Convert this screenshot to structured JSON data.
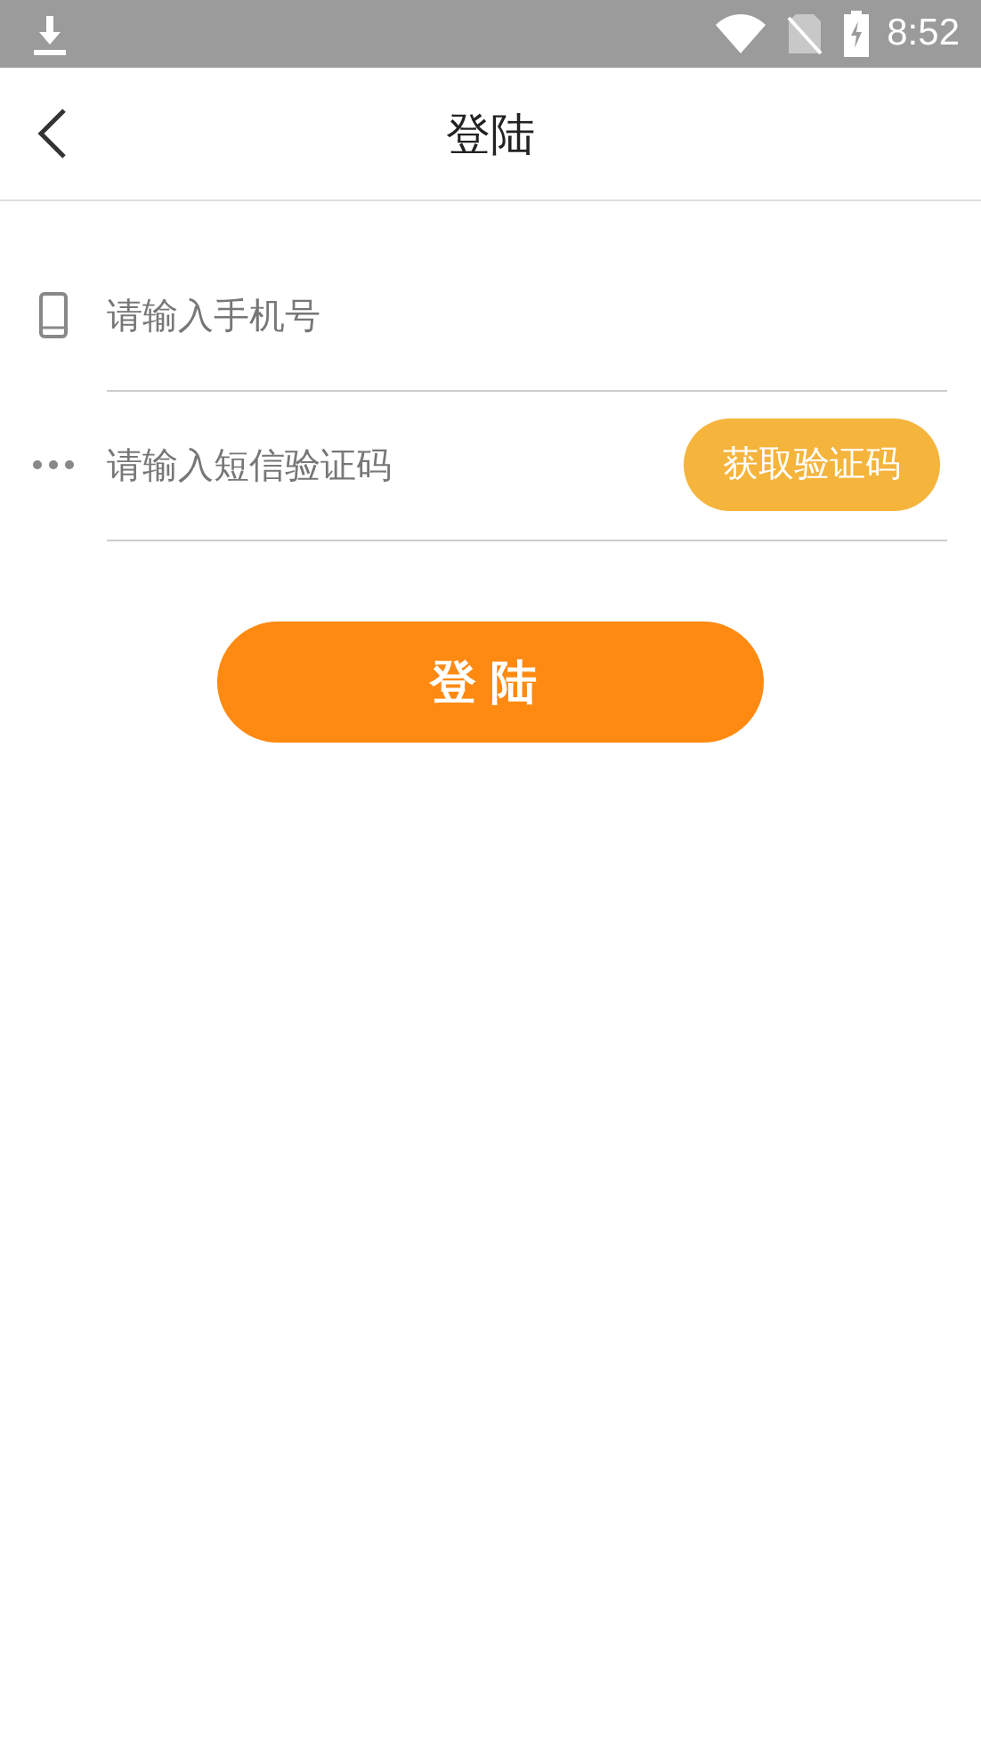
{
  "status_bar": {
    "time": "8:52"
  },
  "header": {
    "title": "登陆"
  },
  "fields": [
    {
      "kind": "phone",
      "placeholder": "请输入手机号"
    },
    {
      "kind": "code",
      "placeholder": "请输入短信验证码",
      "button": "获取验证码"
    }
  ],
  "login_button": "登陆"
}
